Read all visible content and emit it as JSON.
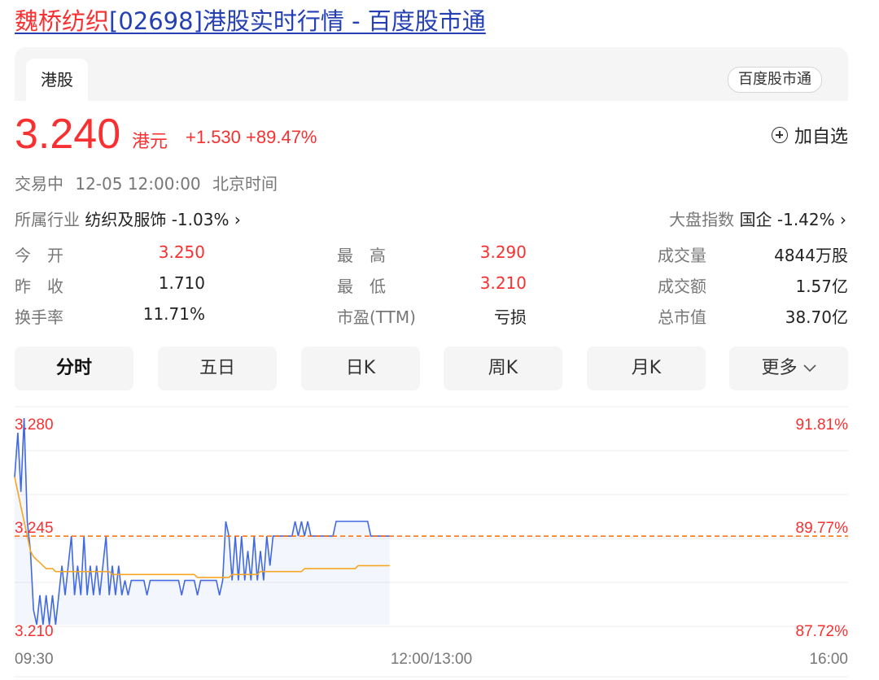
{
  "page": {
    "title_highlight": "魏桥纺织",
    "title_rest": "[02698]港股实时行情 - 百度股市通"
  },
  "tabs": {
    "active": "港股",
    "source_badge": "百度股市通"
  },
  "quote": {
    "price": "3.240",
    "currency": "港元",
    "change": "+1.530",
    "change_pct": "+89.47%",
    "add_watch": "加自选",
    "status": "交易中",
    "time": "12-05 12:00:00",
    "timezone": "北京时间"
  },
  "industry": {
    "label": "所属行业",
    "value": "纺织及服饰 -1.03% ›"
  },
  "market_index": {
    "label": "大盘指数",
    "value": "国企 -1.42% ›"
  },
  "stats": [
    [
      {
        "label": "今　开",
        "value": "3.250",
        "red": true
      },
      {
        "label": "最　高",
        "value": "3.290",
        "red": true
      },
      {
        "label": "成交量",
        "value": "4844万股",
        "red": false
      }
    ],
    [
      {
        "label": "昨　收",
        "value": "1.710",
        "red": false
      },
      {
        "label": "最　低",
        "value": "3.210",
        "red": true
      },
      {
        "label": "成交额",
        "value": "1.57亿",
        "red": false
      }
    ],
    [
      {
        "label": "换手率",
        "value": "11.71%",
        "red": false
      },
      {
        "label": "市盈(TTM)",
        "value": "亏损",
        "red": false
      },
      {
        "label": "总市值",
        "value": "38.70亿",
        "red": false
      }
    ]
  ],
  "range_tabs": [
    "分时",
    "五日",
    "日K",
    "周K",
    "月K",
    "更多"
  ],
  "colors": {
    "accent_red": "#f73131",
    "link_blue": "#2440b3",
    "price_line": "#4169e1",
    "avg_line": "#f5a623",
    "ref_line": "#ff6a00"
  },
  "chart_data": {
    "type": "line",
    "y_labels_left": [
      "3.280",
      "3.245",
      "3.210"
    ],
    "y_labels_right": [
      "91.81%",
      "89.77%",
      "87.72%"
    ],
    "x_labels": [
      "09:30",
      "12:00/13:00",
      "16:00"
    ],
    "ylim": [
      3.21,
      3.28
    ],
    "reference_price": 3.24,
    "series": [
      {
        "values": [
          3.26,
          3.275,
          3.255,
          3.28,
          3.245,
          3.235,
          3.215,
          3.21,
          3.22,
          3.21,
          3.22,
          3.21,
          3.22,
          3.21,
          3.22,
          3.23,
          3.22,
          3.23,
          3.24,
          3.22,
          3.23,
          3.22,
          3.24,
          3.22,
          3.23,
          3.22,
          3.23,
          3.22,
          3.23,
          3.24,
          3.22,
          3.23,
          3.22,
          3.23,
          3.22,
          3.225,
          3.22,
          3.225,
          3.225,
          3.225,
          3.225,
          3.225,
          3.22,
          3.225,
          3.225,
          3.225,
          3.225,
          3.225,
          3.225,
          3.225,
          3.225,
          3.225,
          3.225,
          3.22,
          3.225,
          3.225,
          3.225,
          3.225,
          3.22,
          3.225,
          3.225,
          3.225,
          3.225,
          3.225,
          3.225,
          3.22,
          3.225,
          3.245,
          3.24,
          3.225,
          3.24,
          3.225,
          3.24,
          3.225,
          3.235,
          3.225,
          3.24,
          3.225,
          3.235,
          3.225,
          3.24,
          3.23,
          3.24,
          3.24,
          3.24,
          3.24,
          3.24,
          3.24,
          3.24,
          3.245,
          3.24,
          3.245,
          3.24,
          3.245,
          3.24,
          3.24,
          3.24,
          3.24,
          3.24,
          3.24,
          3.24,
          3.24,
          3.245,
          3.245,
          3.245,
          3.245,
          3.245,
          3.245,
          3.245,
          3.245,
          3.245,
          3.245,
          3.245,
          3.24,
          3.24,
          3.24,
          3.24,
          3.24,
          3.24,
          3.24
        ]
      },
      {
        "values": [
          3.26,
          3.255,
          3.25,
          3.245,
          3.24,
          3.235,
          3.233,
          3.232,
          3.231,
          3.23,
          3.229,
          3.229,
          3.229,
          3.228,
          3.228,
          3.228,
          3.228,
          3.228,
          3.228,
          3.228,
          3.228,
          3.228,
          3.228,
          3.228,
          3.228,
          3.228,
          3.228,
          3.228,
          3.228,
          3.228,
          3.228,
          3.227,
          3.227,
          3.227,
          3.227,
          3.227,
          3.227,
          3.227,
          3.227,
          3.227,
          3.227,
          3.227,
          3.227,
          3.227,
          3.227,
          3.227,
          3.227,
          3.227,
          3.227,
          3.227,
          3.227,
          3.227,
          3.227,
          3.227,
          3.227,
          3.227,
          3.227,
          3.227,
          3.226,
          3.226,
          3.226,
          3.226,
          3.226,
          3.226,
          3.226,
          3.226,
          3.226,
          3.226,
          3.226,
          3.227,
          3.227,
          3.227,
          3.227,
          3.227,
          3.227,
          3.227,
          3.227,
          3.227,
          3.228,
          3.228,
          3.228,
          3.228,
          3.228,
          3.228,
          3.228,
          3.228,
          3.228,
          3.228,
          3.228,
          3.228,
          3.228,
          3.228,
          3.229,
          3.229,
          3.229,
          3.229,
          3.229,
          3.229,
          3.229,
          3.229,
          3.229,
          3.229,
          3.229,
          3.229,
          3.229,
          3.229,
          3.229,
          3.229,
          3.229,
          3.23,
          3.23,
          3.23,
          3.23,
          3.23,
          3.23,
          3.23,
          3.23,
          3.23,
          3.23,
          3.23
        ]
      }
    ],
    "session_fraction_shown": 0.45
  }
}
